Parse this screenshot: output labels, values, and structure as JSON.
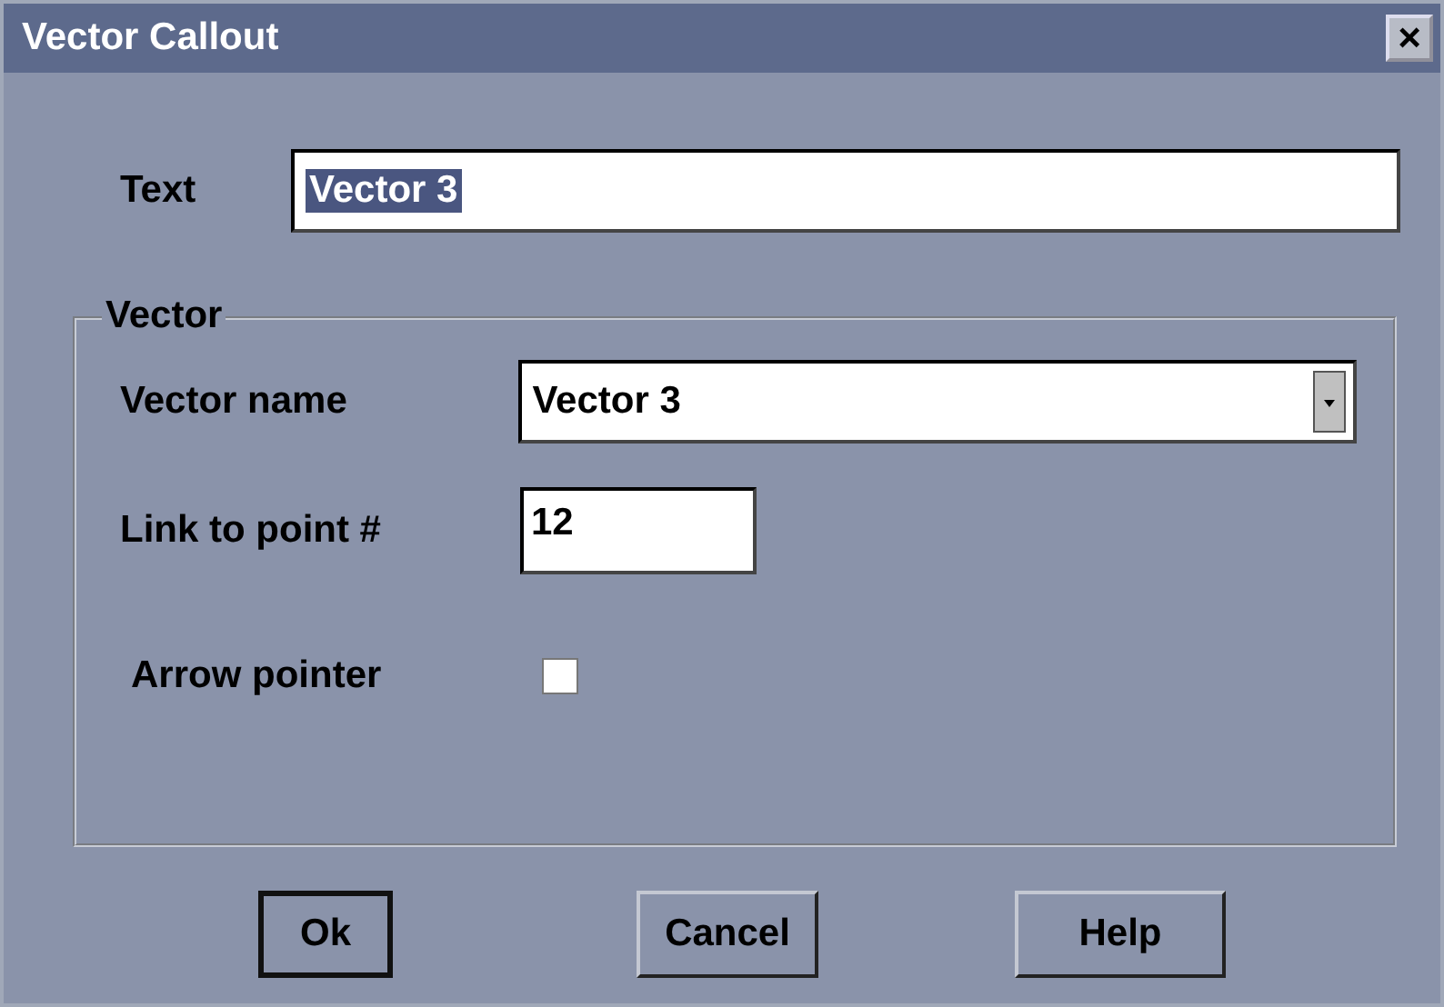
{
  "window": {
    "title": "Vector Callout",
    "close": "×"
  },
  "text_field": {
    "label": "Text",
    "value": "Vector 3",
    "value_selected": true
  },
  "group": {
    "title": "Vector",
    "vector_name": {
      "label": "Vector name",
      "value": "Vector 3"
    },
    "link": {
      "label": "Link to point #",
      "value": "12"
    },
    "arrow": {
      "label": "Arrow pointer",
      "checked": false
    }
  },
  "buttons": [
    {
      "label": "Ok",
      "default": true
    },
    {
      "label": "Cancel",
      "default": false
    },
    {
      "label": "Help",
      "default": false
    }
  ]
}
